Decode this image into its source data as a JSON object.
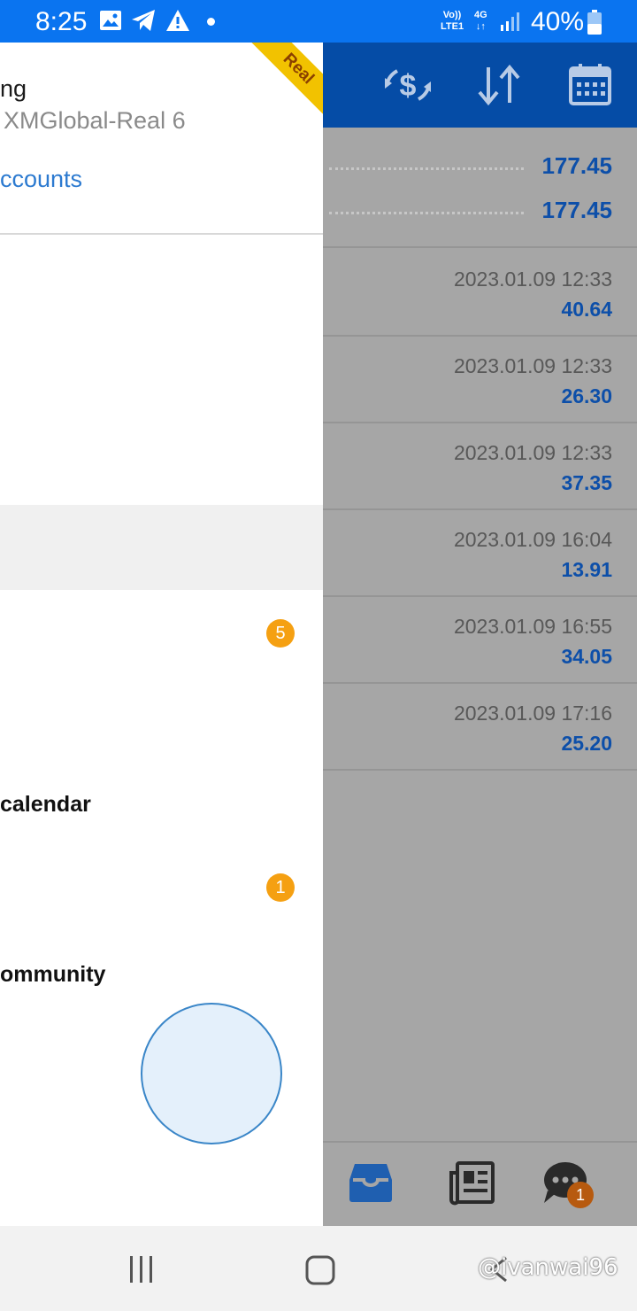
{
  "status_bar": {
    "time": "8:25",
    "volte_top": "Vo))",
    "volte_bottom": "LTE1",
    "network": "4G",
    "battery": "40%",
    "icons": [
      "image-icon",
      "telegram-icon",
      "warning-icon",
      "dot-icon",
      "signal-icon",
      "battery-icon"
    ]
  },
  "drawer": {
    "account_name": "ng",
    "server": "XMGlobal-Real 6",
    "manage_accounts": "ccounts",
    "ribbon": "Real",
    "menu": [
      {
        "label": "",
        "badge": "5"
      },
      {
        "label": "calendar",
        "badge": ""
      },
      {
        "label": "",
        "badge": "1"
      },
      {
        "label": "ommunity",
        "badge": ""
      }
    ]
  },
  "header": {
    "icons": [
      "exchange-dollar-icon",
      "sort-icon",
      "calendar-icon"
    ],
    "background": "#054ca6"
  },
  "summary": {
    "values": [
      "177.45",
      "177.45"
    ]
  },
  "history": [
    {
      "date": "2023.01.09 12:33",
      "value": "40.64"
    },
    {
      "date": "2023.01.09 12:33",
      "value": "26.30"
    },
    {
      "date": "2023.01.09 12:33",
      "value": "37.35"
    },
    {
      "date": "2023.01.09 16:04",
      "value": "13.91"
    },
    {
      "date": "2023.01.09 16:55",
      "value": "34.05"
    },
    {
      "date": "2023.01.09 17:16",
      "value": "25.20"
    }
  ],
  "bottom_tabs": {
    "icons": [
      "inbox-icon",
      "news-icon",
      "chat-icon"
    ],
    "chat_badge": "1"
  },
  "nav_bar": {
    "icons": [
      "recent-apps-icon",
      "home-icon",
      "back-icon"
    ],
    "watermark": "@ivanwai96"
  },
  "colors": {
    "status_bar": "#0a74f0",
    "accent_blue": "#0d4fa9",
    "badge_orange": "#f5a012",
    "ribbon_yellow": "#f2c200"
  }
}
